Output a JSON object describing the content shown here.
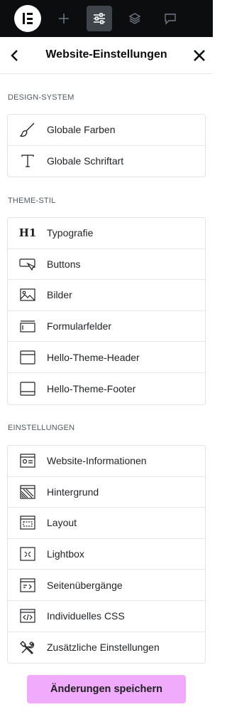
{
  "colors": {
    "topbar": "#0c0d0e",
    "accent_button": "#f0abfc",
    "active_tool": "#3f444b"
  },
  "topbar": {
    "tools": [
      {
        "icon": "elementor-logo"
      },
      {
        "icon": "plus-icon"
      },
      {
        "icon": "sliders-icon",
        "active": true
      },
      {
        "icon": "layers-icon"
      },
      {
        "icon": "chat-icon"
      }
    ]
  },
  "header": {
    "title": "Website-Einstellungen"
  },
  "sections": [
    {
      "label": "DESIGN-SYSTEM",
      "items": [
        {
          "label": "Globale Farben",
          "icon": "brush-icon"
        },
        {
          "label": "Globale Schriftart",
          "icon": "font-t-icon"
        }
      ]
    },
    {
      "label": "THEME-STIL",
      "items": [
        {
          "label": "Typografie",
          "icon": "h1-icon"
        },
        {
          "label": "Buttons",
          "icon": "button-cursor-icon"
        },
        {
          "label": "Bilder",
          "icon": "image-icon"
        },
        {
          "label": "Formularfelder",
          "icon": "form-field-icon"
        },
        {
          "label": "Hello-Theme-Header",
          "icon": "header-layout-icon"
        },
        {
          "label": "Hello-Theme-Footer",
          "icon": "footer-layout-icon"
        }
      ]
    },
    {
      "label": "EINSTELLUNGEN",
      "items": [
        {
          "label": "Website-Informationen",
          "icon": "site-identity-icon"
        },
        {
          "label": "Hintergrund",
          "icon": "background-icon"
        },
        {
          "label": "Layout",
          "icon": "layout-icon"
        },
        {
          "label": "Lightbox",
          "icon": "lightbox-icon"
        },
        {
          "label": "Seitenübergänge",
          "icon": "page-transitions-icon"
        },
        {
          "label": "Individuelles CSS",
          "icon": "code-icon"
        },
        {
          "label": "Zusätzliche Einstellungen",
          "icon": "tools-icon"
        }
      ]
    }
  ],
  "footer": {
    "save_label": "Änderungen speichern"
  }
}
